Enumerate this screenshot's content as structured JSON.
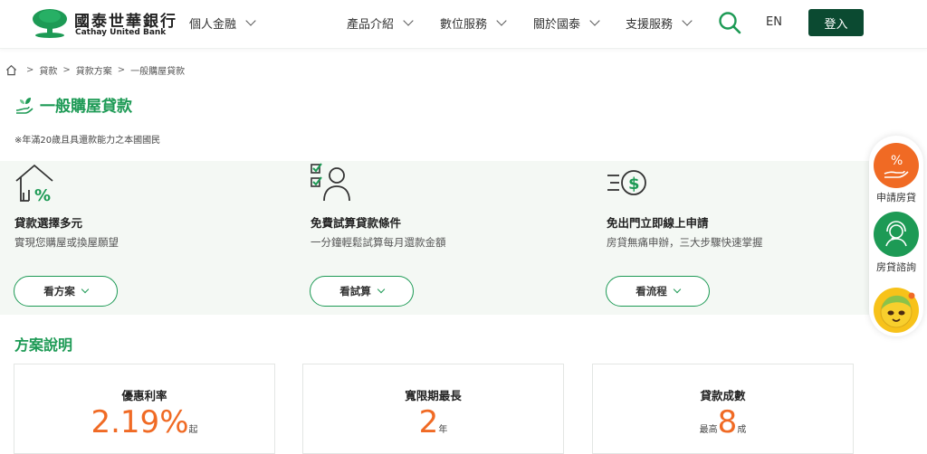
{
  "header": {
    "brand_cn": "國泰世華銀行",
    "brand_en": "Cathay United Bank",
    "personal": "個人金融",
    "nav": [
      "產品介紹",
      "數位服務",
      "關於國泰",
      "支援服務"
    ],
    "lang": "EN",
    "login": "登入"
  },
  "breadcrumb": [
    "貸款",
    "貸款方案",
    "一般購屋貸款"
  ],
  "page": {
    "title": "一般購屋貸款",
    "note": "※年滿20歲且具還款能力之本國國民"
  },
  "features": [
    {
      "title": "貸款選擇多元",
      "desc": "實現您購屋或換屋願望",
      "button": "看方案",
      "icon": "house-percent-icon"
    },
    {
      "title": "免費試算貸款條件",
      "desc": "一分鐘輕鬆試算每月還款金額",
      "button": "看試算",
      "icon": "checklist-person-icon"
    },
    {
      "title": "免出門立即線上申請",
      "desc": "房貸無痛申辦，三大步驟快速掌握",
      "button": "看流程",
      "icon": "fast-dollar-icon"
    }
  ],
  "plans": {
    "title": "方案說明",
    "stats": [
      {
        "label": "優惠利率",
        "prefix": "",
        "value": "2.19%",
        "suffix": "起"
      },
      {
        "label": "寬限期最長",
        "prefix": "",
        "value": "2",
        "suffix": "年"
      },
      {
        "label": "貸款成數",
        "prefix": "最高",
        "value": "8",
        "suffix": "成"
      }
    ]
  },
  "sidebar": {
    "apply": "申請房貸",
    "consult": "房貸諮詢"
  },
  "colors": {
    "brand_green": "#1d9a55",
    "dark_green": "#0b4a31",
    "accent_orange": "#f06a24"
  }
}
